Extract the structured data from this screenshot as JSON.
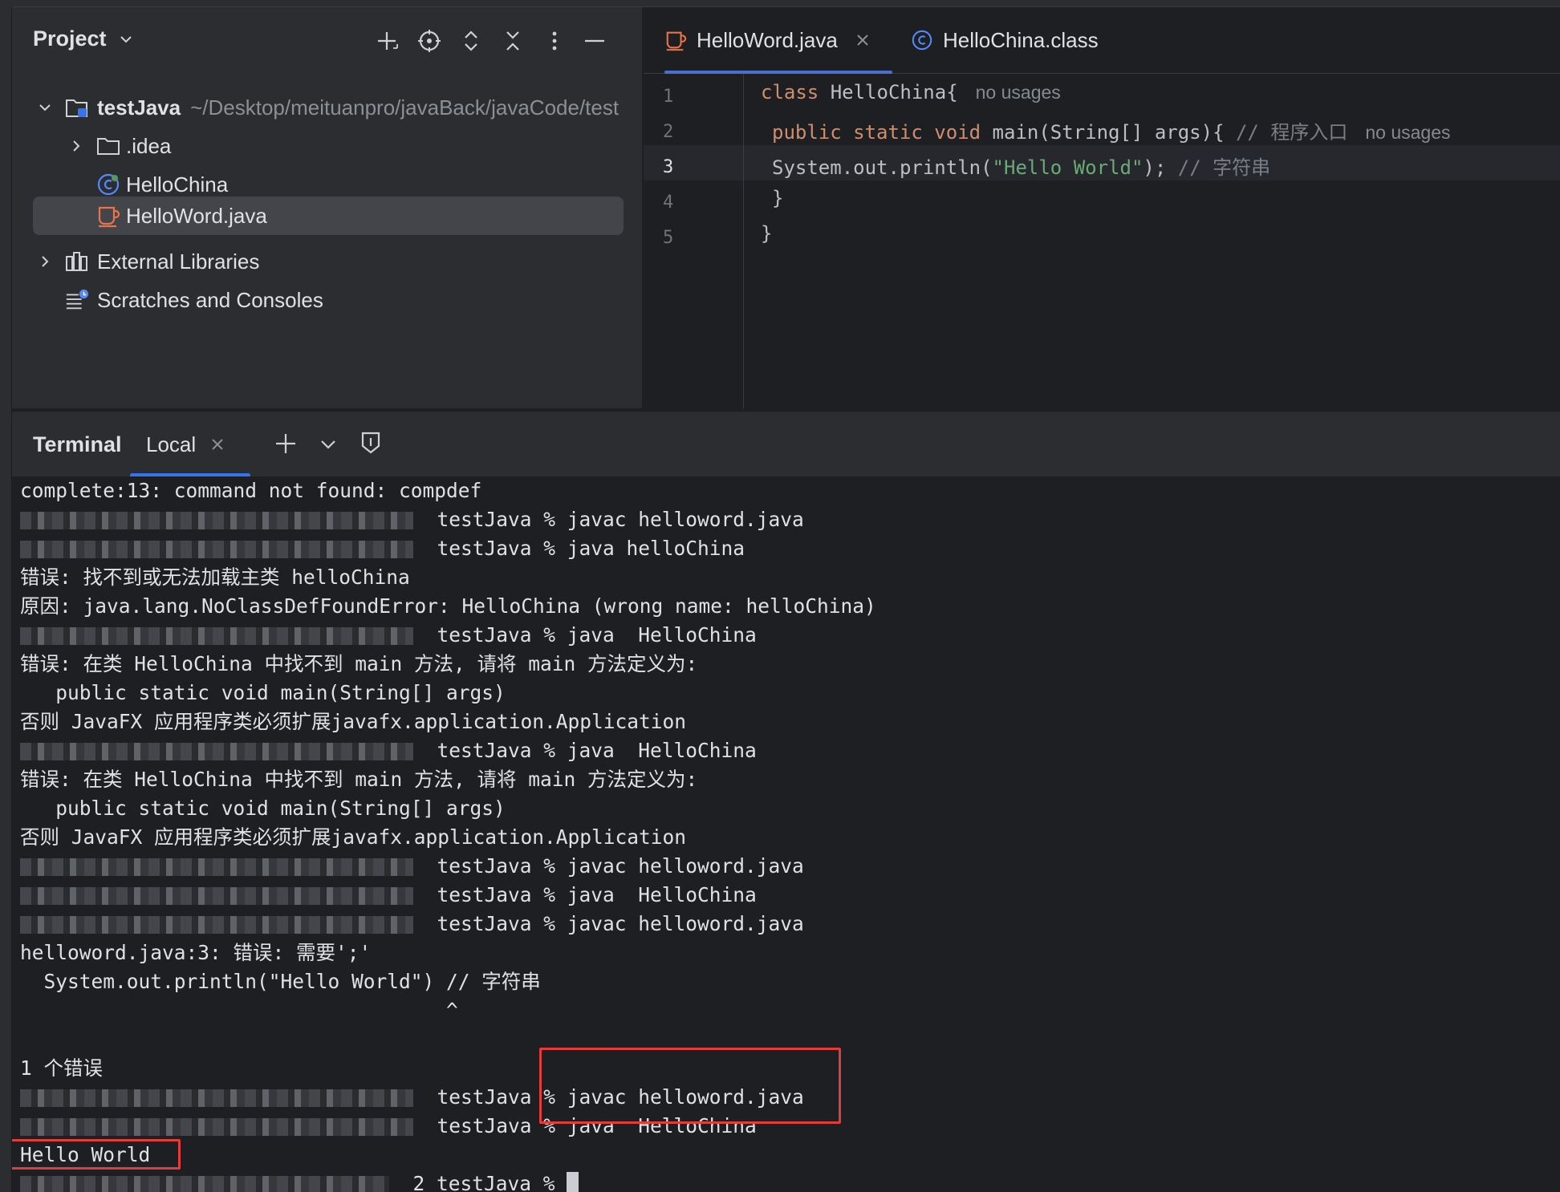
{
  "project": {
    "title": "Project",
    "tree": {
      "root_label": "testJava",
      "root_path": "~/Desktop/meituanpro/javaBack/javaCode/test",
      "idea_label": ".idea",
      "hellochina_label": "HelloChina",
      "helloword_label": "HelloWord.java",
      "external_label": "External Libraries",
      "scratches_label": "Scratches and Consoles"
    }
  },
  "editor": {
    "tabs": [
      {
        "label": "HelloWord.java"
      },
      {
        "label": "HelloChina.class"
      }
    ],
    "line_numbers": [
      "1",
      "2",
      "3",
      "4",
      "5"
    ],
    "code": {
      "l1_kw": "class",
      "l1_rest": " HelloChina{",
      "l1_hint": "no usages",
      "l2_kw": "public static void",
      "l2_rest": " main(String[] args){ ",
      "l2_comment": "// 程序入口",
      "l2_hint": "no usages",
      "l3_pre": "System.out.println(",
      "l3_str": "\"Hello World\"",
      "l3_post": "); ",
      "l3_comment": "// 字符串",
      "l4": "}",
      "l5": "}"
    }
  },
  "terminal": {
    "title": "Terminal",
    "tab_label": "Local",
    "lines": [
      {
        "text": "complete:13: command not found: compdef"
      },
      {
        "text": "testJava % javac helloword.java"
      },
      {
        "text": "testJava % java helloChina"
      },
      {
        "text": "错误: 找不到或无法加载主类 helloChina"
      },
      {
        "text": "原因: java.lang.NoClassDefFoundError: HelloChina (wrong name: helloChina)"
      },
      {
        "text": "testJava % java  HelloChina"
      },
      {
        "text": "错误: 在类 HelloChina 中找不到 main 方法, 请将 main 方法定义为:"
      },
      {
        "text": "   public static void main(String[] args)"
      },
      {
        "text": "否则 JavaFX 应用程序类必须扩展javafx.application.Application"
      },
      {
        "text": "testJava % java  HelloChina"
      },
      {
        "text": "错误: 在类 HelloChina 中找不到 main 方法, 请将 main 方法定义为:"
      },
      {
        "text": "   public static void main(String[] args)"
      },
      {
        "text": "否则 JavaFX 应用程序类必须扩展javafx.application.Application"
      },
      {
        "text": "testJava % javac helloword.java"
      },
      {
        "text": "testJava % java  HelloChina"
      },
      {
        "text": "testJava % javac helloword.java"
      },
      {
        "text": "helloword.java:3: 错误: 需要';'"
      },
      {
        "text": "  System.out.println(\"Hello World\") // 字符串"
      },
      {
        "text": "                                    ^"
      },
      {
        "text": ""
      },
      {
        "text": "1 个错误"
      },
      {
        "text": "testJava % javac helloword.java"
      },
      {
        "text": "testJava % java  HelloChina"
      },
      {
        "text": "Hello World"
      },
      {
        "text": "2 testJava % "
      }
    ]
  },
  "colors": {
    "accent": "#3574f0",
    "highlight_box": "#e53b3b",
    "keyword": "#cf8e6d",
    "string": "#6aab73"
  }
}
